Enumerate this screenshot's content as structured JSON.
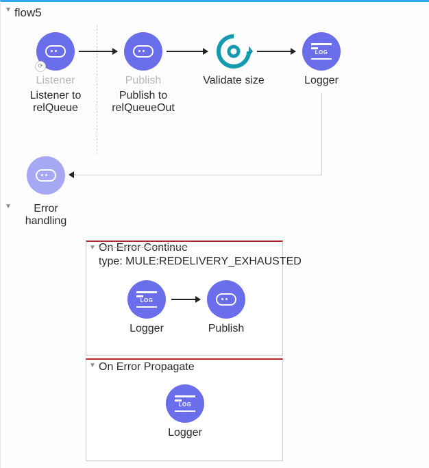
{
  "flow": {
    "name": "flow5"
  },
  "mainFlow": {
    "listener": {
      "type": "Listener",
      "label": "Listener to relQueue"
    },
    "publish": {
      "type": "Publish",
      "label": "Publish to relQueueOut"
    },
    "validate": {
      "label": "Validate size"
    },
    "logger": {
      "label": "Logger"
    }
  },
  "errorHandling": {
    "title": "Error handling",
    "onErrorContinue": {
      "title": "On Error Continue",
      "type": "type: MULE:REDELIVERY_EXHAUSTED",
      "logger": "Logger",
      "publish": "Publish"
    },
    "onErrorPropagate": {
      "title": "On Error Propagate",
      "logger": "Logger"
    }
  }
}
